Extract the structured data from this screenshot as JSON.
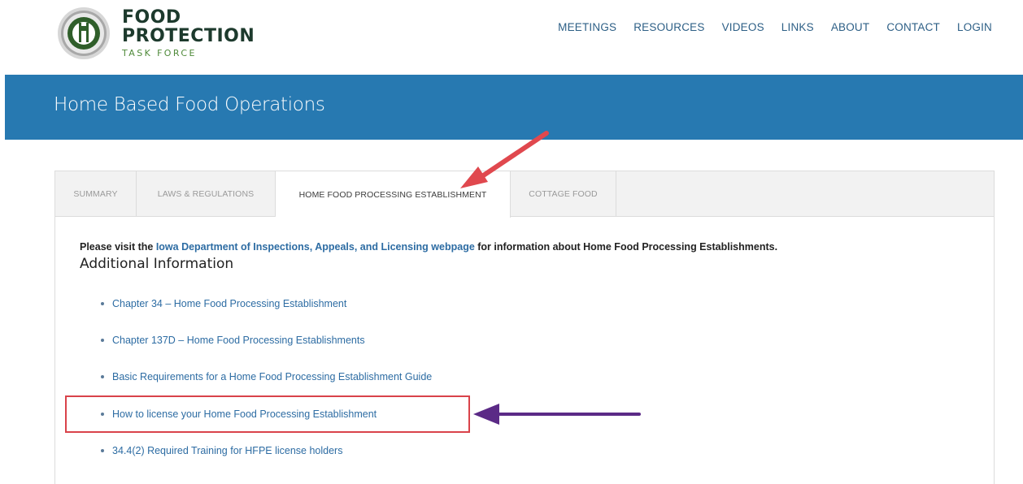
{
  "logo": {
    "line1": "FOOD",
    "line2": "PROTECTION",
    "line3": "TASK FORCE"
  },
  "nav": {
    "items": [
      "MEETINGS",
      "RESOURCES",
      "VIDEOS",
      "LINKS",
      "ABOUT",
      "CONTACT",
      "LOGIN"
    ]
  },
  "banner": {
    "title": "Home Based Food Operations"
  },
  "tabs": [
    {
      "label": "SUMMARY"
    },
    {
      "label": "LAWS & REGULATIONS"
    },
    {
      "label": "HOME FOOD PROCESSING ESTABLISHMENT"
    },
    {
      "label": "COTTAGE FOOD"
    }
  ],
  "content": {
    "intro_prefix": "Please visit the ",
    "intro_link": "Iowa Department of Inspections, Appeals, and Licensing webpage",
    "intro_suffix": " for information about Home Food Processing Establishments.",
    "heading": "Additional Information",
    "links": [
      "Chapter 34 – Home Food Processing Establishment",
      "Chapter 137D – Home Food Processing Establishments",
      "Basic Requirements  for a Home Food Processing Establishment Guide",
      "How to license your Home Food Processing Establishment",
      "34.4(2) Required Training for HFPE license holders"
    ]
  },
  "colors": {
    "banner": "#2779b1",
    "link": "#2d6ca3",
    "annotation_red": "#e0484e",
    "annotation_purple": "#5b2a86"
  }
}
